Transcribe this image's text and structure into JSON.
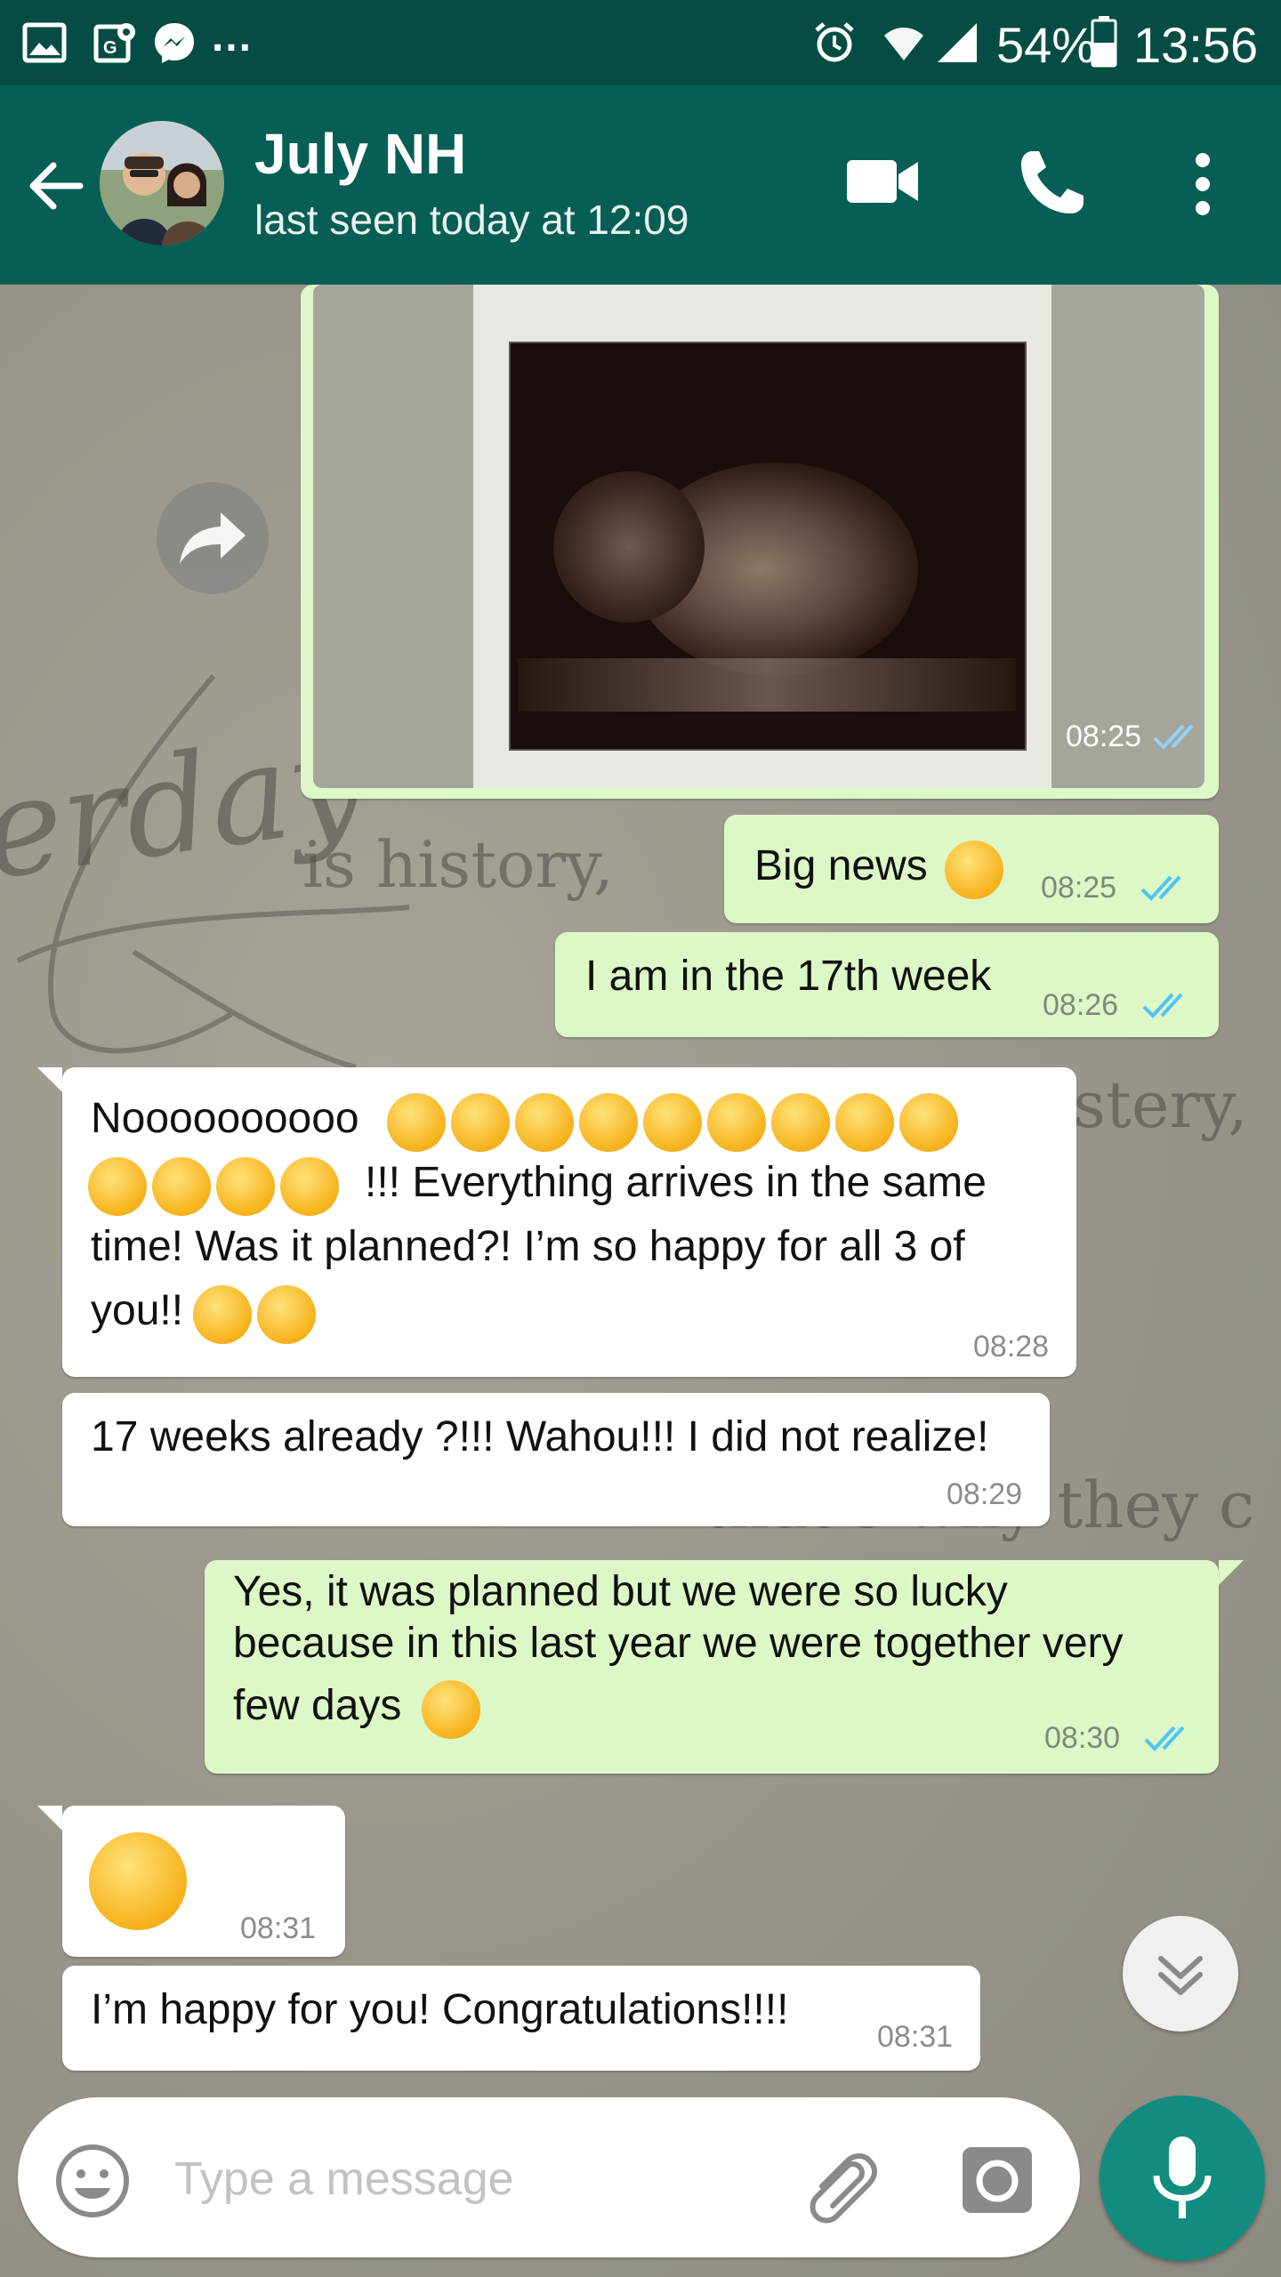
{
  "status_bar": {
    "dots": "...",
    "battery": "54%",
    "time": "13:56"
  },
  "header": {
    "contact_name": "July NH",
    "last_seen": "last seen today at 12:09"
  },
  "messages": [
    {
      "id": "m1",
      "type": "image",
      "time": "08:25"
    },
    {
      "id": "m2",
      "direction": "out",
      "lines": [
        "Big news"
      ],
      "time": "08:25"
    },
    {
      "id": "m3",
      "direction": "out",
      "lines": [
        "I am in the 17th week"
      ],
      "time": "08:26"
    },
    {
      "id": "m4",
      "direction": "in",
      "lines": [
        "Noooooooooo",
        "!!! Everything arrives in the same",
        "time! Was it planned?! I’m so happy for all 3 of",
        "you!!"
      ],
      "time": "08:28"
    },
    {
      "id": "m5",
      "direction": "in",
      "lines": [
        "17 weeks already ?!!! Wahou!!! I did not realize!"
      ],
      "time": "08:29"
    },
    {
      "id": "m6",
      "direction": "out",
      "lines": [
        "Yes, it was planned but we were so lucky",
        "because in this last year we were together very",
        "few days"
      ],
      "time": "08:30"
    },
    {
      "id": "m7",
      "direction": "in",
      "lines": [],
      "time": "08:31"
    },
    {
      "id": "m8",
      "direction": "in",
      "lines": [
        "I’m happy for you! Congratulations!!!!"
      ],
      "time": "08:31"
    }
  ],
  "background_text": [
    "erday",
    "is history,",
    "stery,",
    "that's why they c"
  ],
  "input": {
    "placeholder": "Type a message"
  },
  "icons": [
    "gallery-icon",
    "maps-icon",
    "messenger-icon",
    "alarm-icon",
    "wifi-icon",
    "signal-icon",
    "battery-icon",
    "back-arrow-icon",
    "video-call-icon",
    "voice-call-icon",
    "more-options-icon",
    "forward-icon",
    "emoji-icon",
    "attach-icon",
    "camera-icon",
    "mic-icon",
    "double-chevron-down-icon"
  ],
  "colors": {
    "header": "#075e54",
    "status_bar": "#054d44",
    "outgoing_bubble": "#dcf8c6",
    "incoming_bubble": "#ffffff",
    "read_ticks": "#4fc3f7",
    "accent": "#128c7e"
  }
}
